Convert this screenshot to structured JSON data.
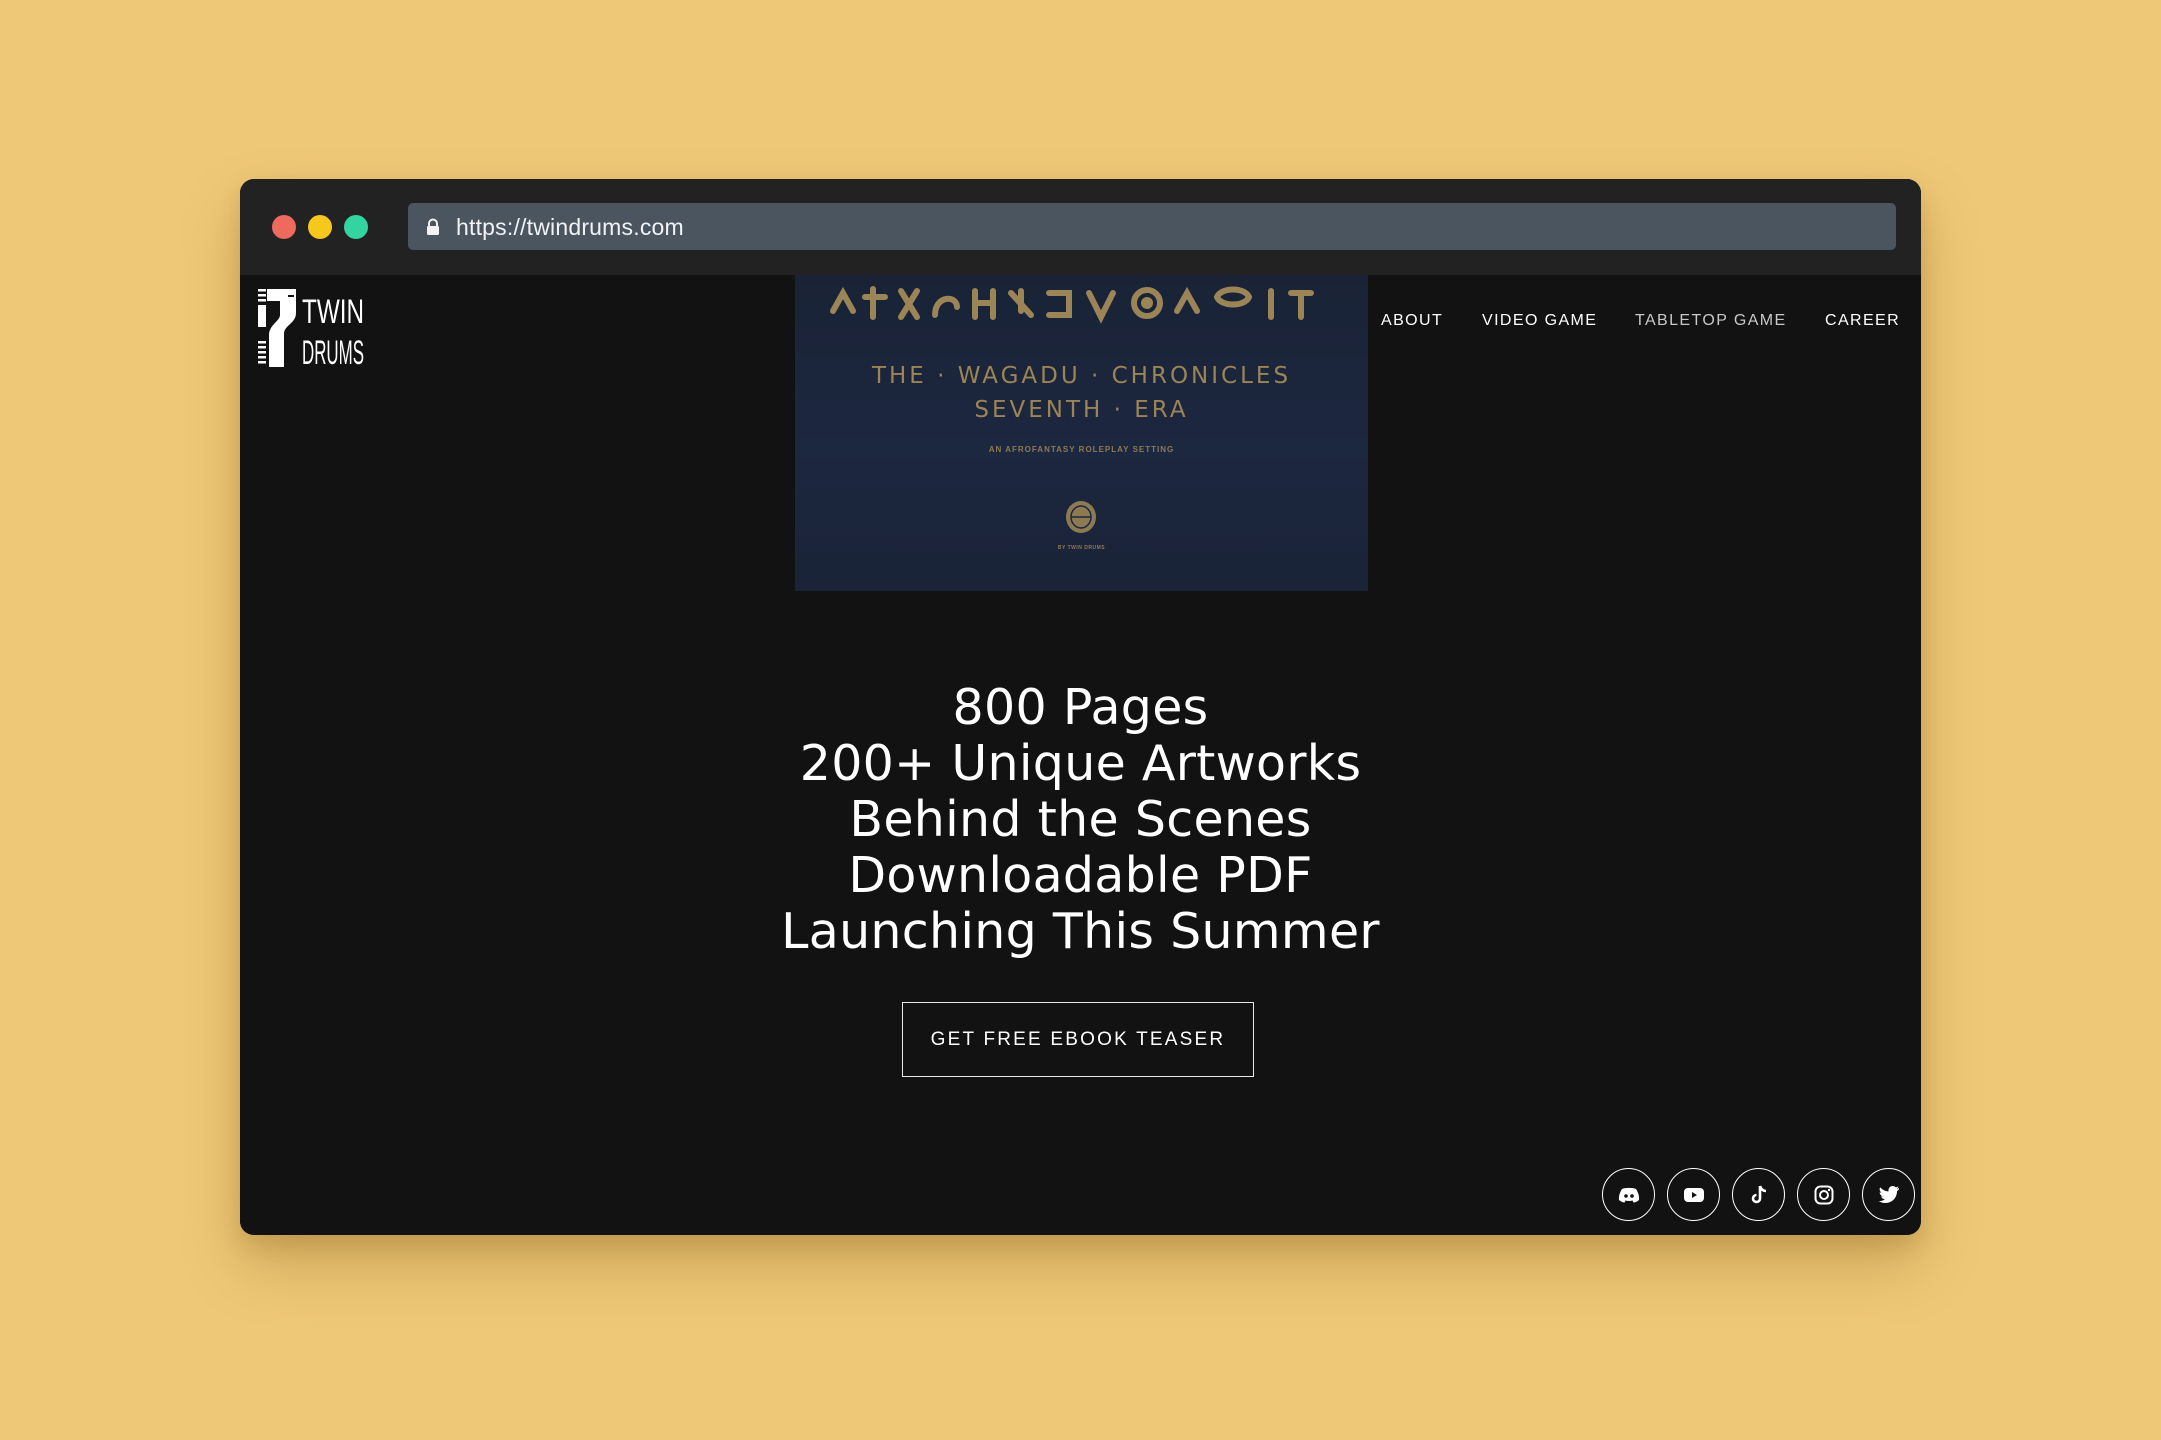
{
  "browser": {
    "url": "https://twindrums.com",
    "window_controls": [
      "close",
      "minimize",
      "maximize"
    ]
  },
  "site": {
    "logo_text": [
      "TWIN",
      "DRUMS"
    ],
    "nav": [
      {
        "label": "ABOUT",
        "active": false
      },
      {
        "label": "VIDEO GAME",
        "active": false
      },
      {
        "label": "TABLETOP GAME",
        "active": true
      },
      {
        "label": "CAREER",
        "active": false
      }
    ]
  },
  "cover": {
    "title_line1": "THE · WAGADU · CHRONICLES",
    "title_line2": "SEVENTH · ERA",
    "subtitle": "AN AFROFANTASY ROLEPLAY SETTING",
    "byline": "BY TWIN DRUMS",
    "accent_color": "#9b8455"
  },
  "features": [
    "800 Pages",
    "200+ Unique Artworks",
    "Behind the Scenes",
    "Downloadable PDF",
    "Launching This Summer"
  ],
  "cta": {
    "label": "GET FREE EBOOK TEASER"
  },
  "social": [
    {
      "name": "discord-icon"
    },
    {
      "name": "youtube-icon"
    },
    {
      "name": "tiktok-icon"
    },
    {
      "name": "instagram-icon"
    },
    {
      "name": "twitter-icon"
    }
  ],
  "colors": {
    "page_background": "#efc877",
    "site_background": "#121212",
    "titlebar": "#222222",
    "urlbar": "#4a5560"
  }
}
